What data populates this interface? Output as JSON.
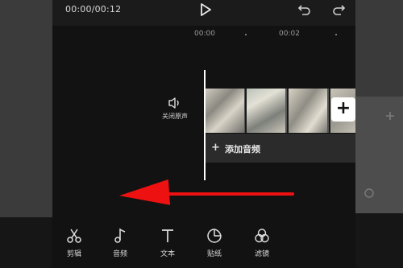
{
  "header": {
    "time": "00:00/00:12",
    "play_icon": "play-icon",
    "undo_icon": "undo-icon",
    "redo_icon": "redo-icon"
  },
  "ruler": {
    "labels": [
      "00:00",
      "00:02"
    ]
  },
  "track": {
    "mute_label": "关闭原声",
    "mute_icon": "speaker-icon",
    "add_clip_icon": "plus-icon",
    "add_audio_label": "添加音频",
    "add_audio_plus": "+"
  },
  "toolbar": {
    "items": [
      {
        "label": "剪辑",
        "icon": "scissors-icon"
      },
      {
        "label": "音频",
        "icon": "music-note-icon"
      },
      {
        "label": "文本",
        "icon": "text-icon"
      },
      {
        "label": "贴纸",
        "icon": "sticker-icon"
      },
      {
        "label": "滤镜",
        "icon": "filter-icon"
      }
    ]
  },
  "colors": {
    "background": "#121212",
    "annotation_arrow": "#ee1111",
    "playhead": "#ffffff"
  }
}
